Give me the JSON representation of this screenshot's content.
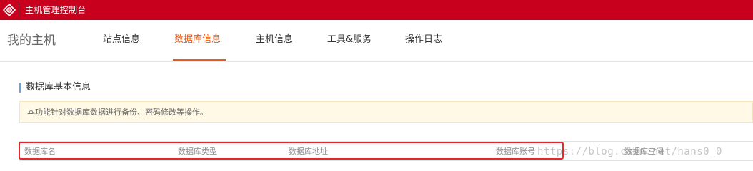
{
  "topbar": {
    "title": "主机管理控制台",
    "background_color": "#c8001e",
    "logo_icon": "brand-logo-icon"
  },
  "nav": {
    "brand": "我的主机",
    "tabs": [
      {
        "label": "站点信息",
        "active": false
      },
      {
        "label": "数据库信息",
        "active": true
      },
      {
        "label": "主机信息",
        "active": false
      },
      {
        "label": "工具&服务",
        "active": false
      },
      {
        "label": "操作日志",
        "active": false
      }
    ],
    "active_color": "#e85d1a"
  },
  "section": {
    "title": "数据库基本信息",
    "notice": "本功能针对数据库数据进行备份、密码修改等操作。"
  },
  "table": {
    "columns": [
      "数据库名",
      "数据库类型",
      "数据库地址",
      "数据库账号",
      "数据库空间"
    ]
  },
  "watermark": "https://blog.csdn.net/hans0_0",
  "highlight_color": "#e8262a"
}
